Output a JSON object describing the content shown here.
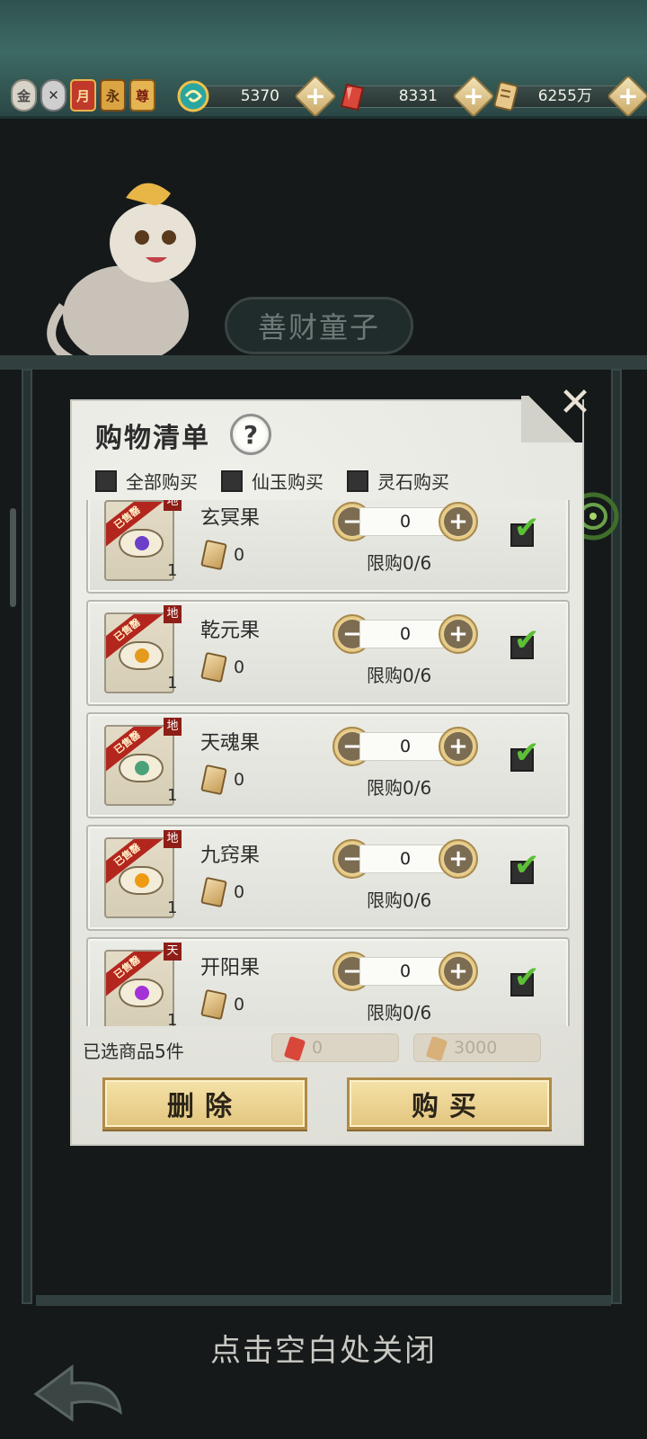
{
  "topbar": {
    "badges": [
      {
        "label": "金",
        "icon": "gold-badge"
      },
      {
        "label": "",
        "icon": "silver-badge"
      },
      {
        "label": "月",
        "icon": "monthly-card-badge"
      },
      {
        "label": "永",
        "icon": "permanent-card-badge"
      },
      {
        "label": "尊",
        "icon": "vip-badge"
      }
    ],
    "currencies": [
      {
        "name": "仙玉",
        "icon": "jade-swirl-icon",
        "value": "5370"
      },
      {
        "name": "灵石",
        "icon": "red-crystal-icon",
        "value": "8331"
      },
      {
        "name": "银票",
        "icon": "scroll-ticket-icon",
        "value": "6255万"
      }
    ]
  },
  "scene": {
    "npc_title": "善财童子"
  },
  "panel": {
    "title": "购物清单",
    "help_label": "?",
    "close_label": "✕",
    "filters": [
      {
        "label": "全部购买",
        "checked": false
      },
      {
        "label": "仙玉购买",
        "checked": false
      },
      {
        "label": "灵石购买",
        "checked": false
      }
    ],
    "items": [
      {
        "name": "玄冥果",
        "tier": "地",
        "badge": "已售罄",
        "count": "1",
        "price": "0",
        "quantity": "0",
        "limit": "限购0/6",
        "selected": true,
        "orb_color": "#6b3fc8"
      },
      {
        "name": "乾元果",
        "tier": "地",
        "badge": "已售罄",
        "count": "1",
        "price": "0",
        "quantity": "0",
        "limit": "限购0/6",
        "selected": true,
        "orb_color": "#e49a1c"
      },
      {
        "name": "天魂果",
        "tier": "地",
        "badge": "已售罄",
        "count": "1",
        "price": "0",
        "quantity": "0",
        "limit": "限购0/6",
        "selected": true,
        "orb_color": "#4ba27a"
      },
      {
        "name": "九窍果",
        "tier": "地",
        "badge": "已售罄",
        "count": "1",
        "price": "0",
        "quantity": "0",
        "limit": "限购0/6",
        "selected": true,
        "orb_color": "#ee9a12"
      },
      {
        "name": "开阳果",
        "tier": "天",
        "badge": "已售罄",
        "count": "1",
        "price": "0",
        "quantity": "0",
        "limit": "限购0/6",
        "selected": true,
        "orb_color": "#a532d6"
      }
    ],
    "selected_count": "已选商品5件",
    "totals": [
      {
        "currency": "灵石",
        "value": "0",
        "icon": "red-crystal-icon",
        "color": "#d9463a"
      },
      {
        "currency": "银票",
        "value": "3000",
        "icon": "scroll-ticket-icon",
        "color": "#d7b07a"
      }
    ],
    "delete_label": "删除",
    "buy_label": "购买"
  },
  "hint": "点击空白处关闭"
}
